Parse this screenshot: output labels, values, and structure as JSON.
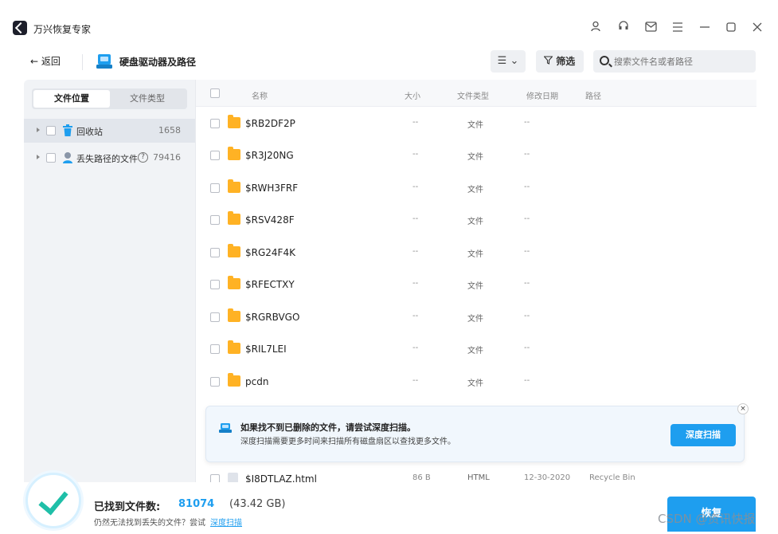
{
  "app": {
    "title": "万兴恢复专家"
  },
  "toolbar": {
    "back_label": "← 返回",
    "drive_title": "硬盘驱动器及路径",
    "view_label": "☰ ⌄",
    "filter_label": "筛选",
    "search_placeholder": "搜索文件名或者路径"
  },
  "sidebar": {
    "tabs": [
      "文件位置",
      "文件类型"
    ],
    "items": [
      {
        "label": "回收站",
        "count": "1658"
      },
      {
        "label": "丢失路径的文件",
        "count": "79416"
      }
    ]
  },
  "table": {
    "headers": {
      "name": "名称",
      "size": "大小",
      "type": "文件类型",
      "date": "修改日期",
      "path": "路径"
    },
    "rows": [
      {
        "name": "$RB2DF2P",
        "size": "--",
        "type": "文件",
        "date": "--",
        "path": ""
      },
      {
        "name": "$R3J20NG",
        "size": "--",
        "type": "文件",
        "date": "--",
        "path": ""
      },
      {
        "name": "$RWH3FRF",
        "size": "--",
        "type": "文件",
        "date": "--",
        "path": ""
      },
      {
        "name": "$RSV428F",
        "size": "--",
        "type": "文件",
        "date": "--",
        "path": ""
      },
      {
        "name": "$RG24F4K",
        "size": "--",
        "type": "文件",
        "date": "--",
        "path": ""
      },
      {
        "name": "$RFECTXY",
        "size": "--",
        "type": "文件",
        "date": "--",
        "path": ""
      },
      {
        "name": "$RGRBVGO",
        "size": "--",
        "type": "文件",
        "date": "--",
        "path": ""
      },
      {
        "name": "$RIL7LEI",
        "size": "--",
        "type": "文件",
        "date": "--",
        "path": ""
      },
      {
        "name": "pcdn",
        "size": "--",
        "type": "文件",
        "date": "--",
        "path": ""
      },
      {
        "name": "$I8DTLAZ.html",
        "size": "86 B",
        "type": "HTML",
        "date": "12-30-2020",
        "path": "Recycle Bin"
      }
    ]
  },
  "tip": {
    "title": "如果找不到已删除的文件，请尝试深度扫描。",
    "subtitle": "深度扫描需要更多时间来扫描所有磁盘扇区以查找更多文件。",
    "button": "深度扫描",
    "close": "×"
  },
  "footer": {
    "found_label": "已找到文件数:",
    "found_count": "81074",
    "found_size": "(43.42 GB)",
    "hint": "仍然无法找到丢失的文件？尝试",
    "hint_link": "深度扫描",
    "recover_button": "恢复"
  },
  "watermark": "CSDN @资讯快报",
  "colors": {
    "accent": "#1e9eef",
    "folder": "#ffb224",
    "check": "#1fbfa8"
  }
}
